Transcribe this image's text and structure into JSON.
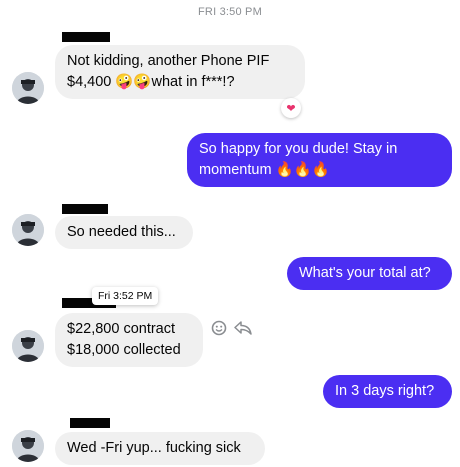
{
  "conversation": {
    "timestamp": "FRI 3:50 PM",
    "tooltip": "Fri 3:52 PM",
    "messages": [
      {
        "id": "m1",
        "from": "them",
        "lines": [
          "Not kidding, another Phone PIF",
          "$4,400 🤪🤪what in f***!?"
        ],
        "reaction": "❤"
      },
      {
        "id": "m2",
        "from": "me",
        "lines": [
          "So happy for you dude!  Stay in",
          "momentum 🔥🔥🔥"
        ]
      },
      {
        "id": "m3",
        "from": "them",
        "lines": [
          "So needed this..."
        ]
      },
      {
        "id": "m4",
        "from": "me",
        "lines": [
          "What's your total at?"
        ]
      },
      {
        "id": "m5",
        "from": "them",
        "lines": [
          "$22,800 contract",
          "$18,000 collected"
        ]
      },
      {
        "id": "m6",
        "from": "me",
        "lines": [
          "In 3 days right?"
        ]
      },
      {
        "id": "m7",
        "from": "them",
        "lines": [
          "Wed -Fri yup... fucking sick"
        ]
      }
    ]
  },
  "icons": {
    "react": "smiley-icon",
    "reply": "reply-arrow-icon",
    "heart": "heart-icon",
    "avatar": "avatar"
  },
  "colors": {
    "outgoing": "#4b2ef2",
    "incoming": "#f0f0f0",
    "heart": "#e8336d"
  }
}
